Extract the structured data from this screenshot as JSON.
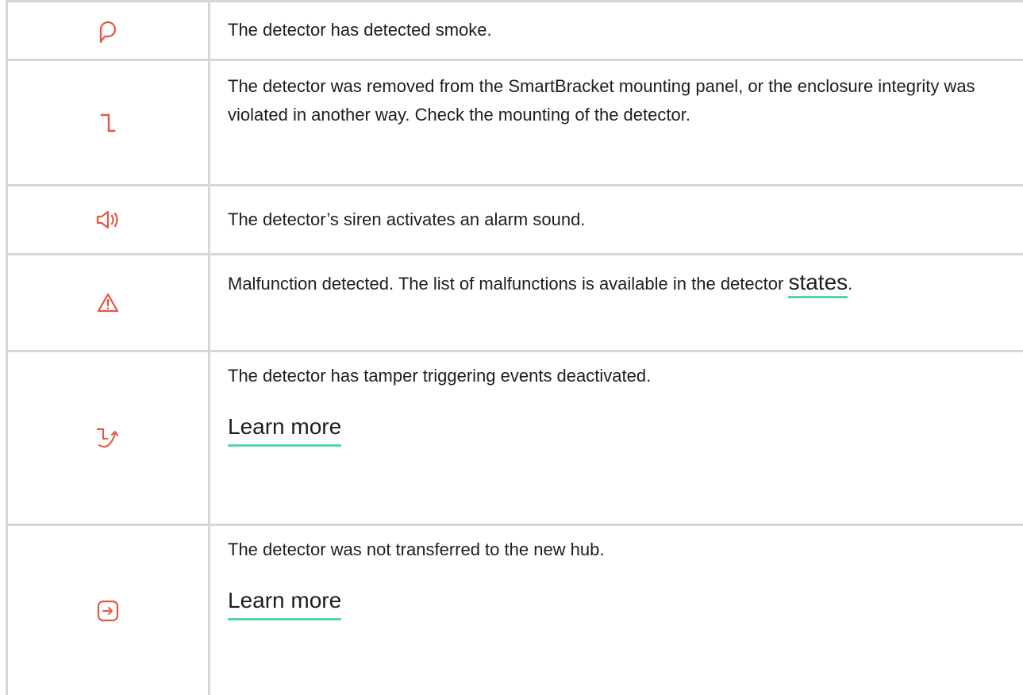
{
  "colors": {
    "icon": "#e8553f",
    "link_underline": "#4fdba0",
    "border": "#d7d7d7",
    "text": "#1e1e1e"
  },
  "rows": [
    {
      "icon": "smoke-icon",
      "text": "The detector has detected smoke."
    },
    {
      "icon": "tamper-icon",
      "text": "The detector was removed from the SmartBracket mounting panel, or the enclosure integrity was violated in another way. Check the mounting of the detector."
    },
    {
      "icon": "siren-icon",
      "text": "The detector’s siren activates an alarm sound."
    },
    {
      "icon": "warning-icon",
      "text_before": "Malfunction detected. The list of malfunctions is available in the detector ",
      "link": "states",
      "text_after": "."
    },
    {
      "icon": "tamper-disabled-icon",
      "text": "The detector has tamper triggering events deactivated.",
      "link": "Learn more"
    },
    {
      "icon": "transfer-icon",
      "text": "The detector was not transferred to the new hub.",
      "link": "Learn more"
    }
  ]
}
